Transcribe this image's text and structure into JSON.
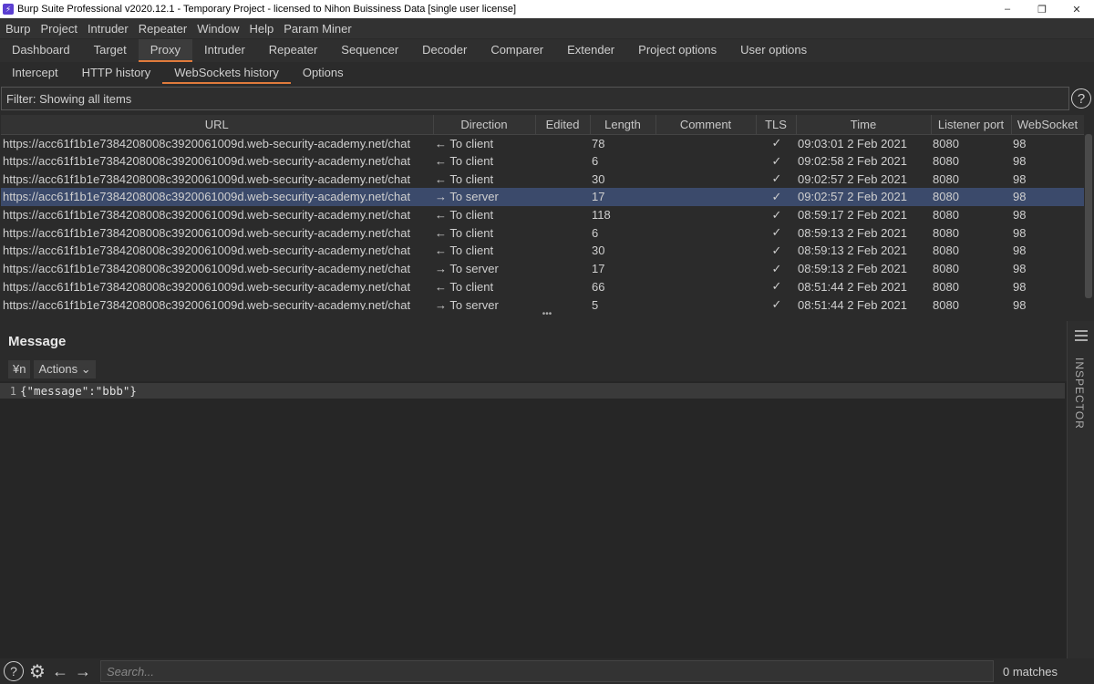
{
  "window": {
    "title": "Burp Suite Professional v2020.12.1 - Temporary Project - licensed to Nihon Buissiness Data [single user license]",
    "minimize": "–",
    "restore": "❐",
    "close": "✕"
  },
  "menu": [
    "Burp",
    "Project",
    "Intruder",
    "Repeater",
    "Window",
    "Help",
    "Param Miner"
  ],
  "main_tabs": [
    "Dashboard",
    "Target",
    "Proxy",
    "Intruder",
    "Repeater",
    "Sequencer",
    "Decoder",
    "Comparer",
    "Extender",
    "Project options",
    "User options"
  ],
  "main_tab_active": "Proxy",
  "sub_tabs": [
    "Intercept",
    "HTTP history",
    "WebSockets history",
    "Options"
  ],
  "sub_tab_active": "WebSockets history",
  "filter": "Filter: Showing all items",
  "table": {
    "columns": [
      "URL",
      "Direction",
      "Edited",
      "Length",
      "Comment",
      "TLS",
      "Time",
      "Listener port",
      "WebSocket"
    ],
    "selected_index": 3,
    "rows": [
      {
        "url": "https://acc61f1b1e7384208008c3920061009d.web-security-academy.net/chat",
        "direction": "← To client",
        "edited": "",
        "length": "78",
        "comment": "",
        "tls": "✓",
        "time": "09:03:01 2 Feb 2021",
        "port": "8080",
        "ws": "98"
      },
      {
        "url": "https://acc61f1b1e7384208008c3920061009d.web-security-academy.net/chat",
        "direction": "← To client",
        "edited": "",
        "length": "6",
        "comment": "",
        "tls": "✓",
        "time": "09:02:58 2 Feb 2021",
        "port": "8080",
        "ws": "98"
      },
      {
        "url": "https://acc61f1b1e7384208008c3920061009d.web-security-academy.net/chat",
        "direction": "← To client",
        "edited": "",
        "length": "30",
        "comment": "",
        "tls": "✓",
        "time": "09:02:57 2 Feb 2021",
        "port": "8080",
        "ws": "98"
      },
      {
        "url": "https://acc61f1b1e7384208008c3920061009d.web-security-academy.net/chat",
        "direction": "→ To server",
        "edited": "",
        "length": "17",
        "comment": "",
        "tls": "✓",
        "time": "09:02:57 2 Feb 2021",
        "port": "8080",
        "ws": "98"
      },
      {
        "url": "https://acc61f1b1e7384208008c3920061009d.web-security-academy.net/chat",
        "direction": "← To client",
        "edited": "",
        "length": "118",
        "comment": "",
        "tls": "✓",
        "time": "08:59:17 2 Feb 2021",
        "port": "8080",
        "ws": "98"
      },
      {
        "url": "https://acc61f1b1e7384208008c3920061009d.web-security-academy.net/chat",
        "direction": "← To client",
        "edited": "",
        "length": "6",
        "comment": "",
        "tls": "✓",
        "time": "08:59:13 2 Feb 2021",
        "port": "8080",
        "ws": "98"
      },
      {
        "url": "https://acc61f1b1e7384208008c3920061009d.web-security-academy.net/chat",
        "direction": "← To client",
        "edited": "",
        "length": "30",
        "comment": "",
        "tls": "✓",
        "time": "08:59:13 2 Feb 2021",
        "port": "8080",
        "ws": "98"
      },
      {
        "url": "https://acc61f1b1e7384208008c3920061009d.web-security-academy.net/chat",
        "direction": "→ To server",
        "edited": "",
        "length": "17",
        "comment": "",
        "tls": "✓",
        "time": "08:59:13 2 Feb 2021",
        "port": "8080",
        "ws": "98"
      },
      {
        "url": "https://acc61f1b1e7384208008c3920061009d.web-security-academy.net/chat",
        "direction": "← To client",
        "edited": "",
        "length": "66",
        "comment": "",
        "tls": "✓",
        "time": "08:51:44 2 Feb 2021",
        "port": "8080",
        "ws": "98"
      },
      {
        "url": "https://acc61f1b1e7384208008c3920061009d.web-security-academy.net/chat",
        "direction": "→ To server",
        "edited": "",
        "length": "5",
        "comment": "",
        "tls": "✓",
        "time": "08:51:44 2 Feb 2021",
        "port": "8080",
        "ws": "98"
      }
    ]
  },
  "message_panel": {
    "title": "Message",
    "newline_button": "¥n",
    "actions_button": "Actions ⌄",
    "line_number": "1",
    "content": "{\"message\":\"bbb\"}"
  },
  "inspector": {
    "label": "INSPECTOR"
  },
  "bottom": {
    "help": "?",
    "settings": "⚙",
    "back": "←",
    "forward": "→",
    "search_placeholder": "Search...",
    "matches": "0 matches"
  }
}
